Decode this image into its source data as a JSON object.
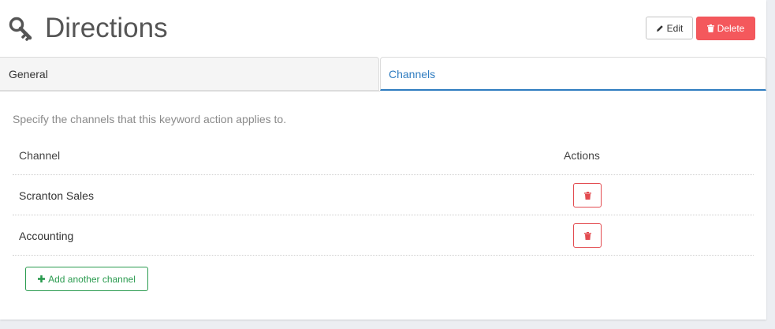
{
  "header": {
    "title": "Directions",
    "edit_label": "Edit",
    "delete_label": "Delete"
  },
  "tabs": [
    {
      "label": "General",
      "active": false
    },
    {
      "label": "Channels",
      "active": true
    }
  ],
  "channels_panel": {
    "description": "Specify the channels that this keyword action applies to.",
    "columns": [
      "Channel",
      "Actions"
    ],
    "rows": [
      {
        "channel": "Scranton Sales"
      },
      {
        "channel": "Accounting"
      }
    ],
    "add_label": "Add another channel"
  },
  "icons": {
    "title_icon": "key-icon",
    "edit_icon": "pencil-icon",
    "delete_icon": "trash-icon",
    "row_remove_icon": "trash-icon",
    "add_icon": "plus-icon"
  },
  "colors": {
    "accent_blue": "#2f7cc0",
    "danger_red": "#f4585c",
    "success_green": "#2a9b4f",
    "background": "#eceef2"
  }
}
